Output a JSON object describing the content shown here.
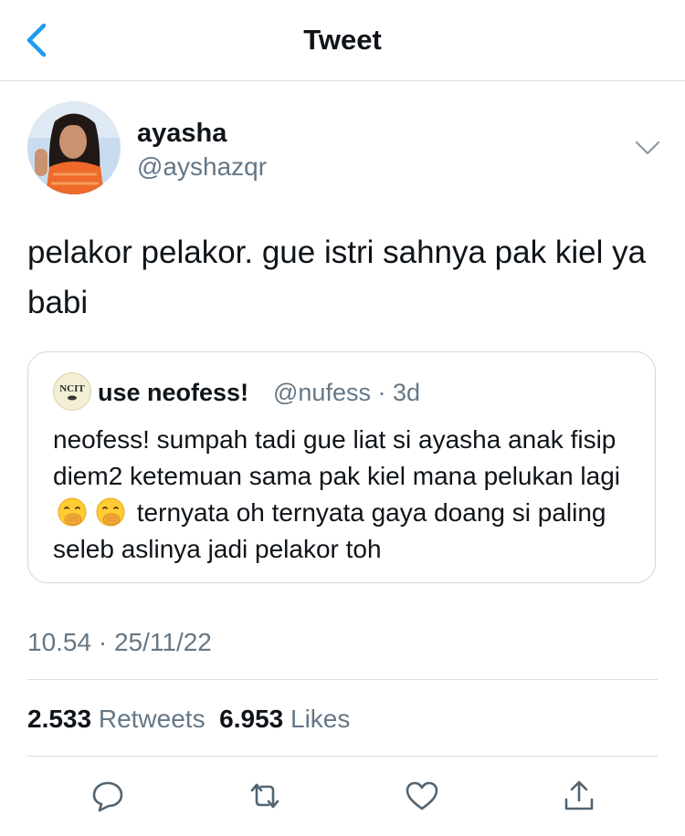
{
  "header": {
    "title": "Tweet",
    "back_icon": "chevron-left-icon"
  },
  "tweet": {
    "author_name": "ayasha",
    "author_handle": "@ayshazqr",
    "text": "pelakor pelakor. gue istri sahnya pak kiel ya babi",
    "timestamp": "10.54 · 25/11/22",
    "retweets_count": "2.533",
    "retweets_label": "Retweets",
    "likes_count": "6.953",
    "likes_label": "Likes"
  },
  "quoted_tweet": {
    "avatar_text": "NCIT",
    "author_name": "use neofess!",
    "author_handle": "@nufess",
    "age": "· 3d",
    "text_part1": "neofess! sumpah tadi gue liat si ayasha anak fisip diem2 ketemuan sama pak kiel mana pelukan lagi",
    "text_part2": "ternyata oh ternyata gaya doang si paling seleb aslinya jadi pelakor toh",
    "emojis": [
      "face-with-hand-over-mouth-emoji",
      "face-with-hand-over-mouth-emoji"
    ]
  },
  "actions": [
    "reply-icon",
    "retweet-icon",
    "like-icon",
    "share-icon"
  ],
  "colors": {
    "accent": "#1d9bf0",
    "secondary_text": "#657786",
    "divider": "#d8dde2"
  }
}
